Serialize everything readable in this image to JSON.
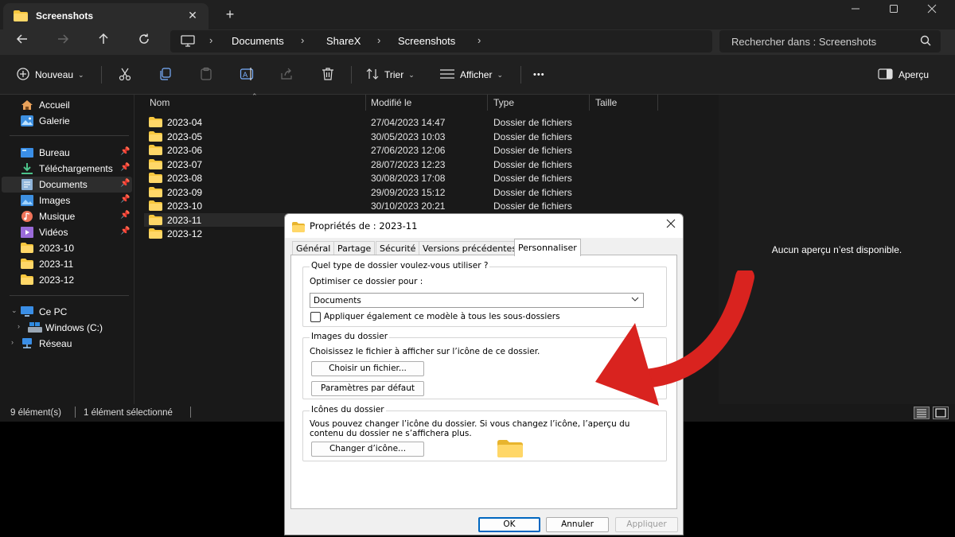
{
  "window": {
    "tab_title": "Screenshots",
    "new_tab_symbol": "+",
    "close_symbol": "✕"
  },
  "address": {
    "crumbs": [
      "Documents",
      "ShareX",
      "Screenshots"
    ],
    "search_placeholder": "Rechercher dans : Screenshots"
  },
  "toolbar": {
    "new_label": "Nouveau",
    "sort_label": "Trier",
    "view_label": "Afficher",
    "more_label": "•••",
    "preview_label": "Aperçu"
  },
  "nav": {
    "items": [
      {
        "label": "Accueil",
        "icon": "home-icon"
      },
      {
        "label": "Galerie",
        "icon": "gallery-icon"
      },
      {
        "label": "Bureau",
        "icon": "desktop-icon",
        "pinned": true
      },
      {
        "label": "Téléchargements",
        "icon": "downloads-icon",
        "pinned": true
      },
      {
        "label": "Documents",
        "icon": "documents-icon",
        "pinned": true,
        "selected": true
      },
      {
        "label": "Images",
        "icon": "pictures-icon",
        "pinned": true
      },
      {
        "label": "Musique",
        "icon": "music-icon",
        "pinned": true
      },
      {
        "label": "Vidéos",
        "icon": "videos-icon",
        "pinned": true
      },
      {
        "label": "2023-10",
        "icon": "folder-icon"
      },
      {
        "label": "2023-11",
        "icon": "folder-icon"
      },
      {
        "label": "2023-12",
        "icon": "folder-icon"
      },
      {
        "label": "Ce PC",
        "icon": "pc-icon"
      },
      {
        "label": "Windows (C:)",
        "icon": "drive-icon"
      },
      {
        "label": "Réseau",
        "icon": "network-icon"
      }
    ]
  },
  "filelist": {
    "columns": [
      "Nom",
      "Modifié le",
      "Type",
      "Taille"
    ],
    "rows": [
      {
        "name": "2023-04",
        "date": "27/04/2023 14:47",
        "type": "Dossier de fichiers"
      },
      {
        "name": "2023-05",
        "date": "30/05/2023 10:03",
        "type": "Dossier de fichiers"
      },
      {
        "name": "2023-06",
        "date": "27/06/2023 12:06",
        "type": "Dossier de fichiers"
      },
      {
        "name": "2023-07",
        "date": "28/07/2023 12:23",
        "type": "Dossier de fichiers"
      },
      {
        "name": "2023-08",
        "date": "30/08/2023 17:08",
        "type": "Dossier de fichiers"
      },
      {
        "name": "2023-09",
        "date": "29/09/2023 15:12",
        "type": "Dossier de fichiers"
      },
      {
        "name": "2023-10",
        "date": "30/10/2023 20:21",
        "type": "Dossier de fichiers"
      },
      {
        "name": "2023-11",
        "date": "",
        "type": "",
        "selected": true
      },
      {
        "name": "2023-12",
        "date": "",
        "type": ""
      }
    ]
  },
  "preview": {
    "message": "Aucun aperçu n’est disponible."
  },
  "status": {
    "count": "9 élément(s)",
    "selection": "1 élément sélectionné"
  },
  "dialog": {
    "title": "Propriétés de : 2023-11",
    "tabs": [
      "Général",
      "Partage",
      "Sécurité",
      "Versions précédentes",
      "Personnaliser"
    ],
    "active_tab": "Personnaliser",
    "group1": {
      "title": "Quel type de dossier voulez-vous utiliser ?",
      "optimize_label": "Optimiser ce dossier pour :",
      "optimize_value": "Documents",
      "apply_subfolders_label": "Appliquer également ce modèle à tous les sous-dossiers",
      "apply_subfolders_checked": false
    },
    "group2": {
      "title": "Images du dossier",
      "description": "Choisissez le fichier à afficher sur l’icône de ce dossier.",
      "choose_file_button": "Choisir un fichier...",
      "restore_default_button": "Paramètres par défaut"
    },
    "group3": {
      "title": "Icônes du dossier",
      "description_line1": "Vous pouvez changer l’icône du dossier. Si vous changez l’icône, l’aperçu du",
      "description_line2": "contenu du dossier ne s’affichera plus.",
      "change_icon_button": "Changer d’icône..."
    },
    "buttons": {
      "ok": "OK",
      "cancel": "Annuler",
      "apply": "Appliquer"
    }
  },
  "colors": {
    "folder_yellow": "#f8c73e",
    "annotation_arrow": "#d9231f",
    "dialog_default_button": "#0067c0"
  }
}
